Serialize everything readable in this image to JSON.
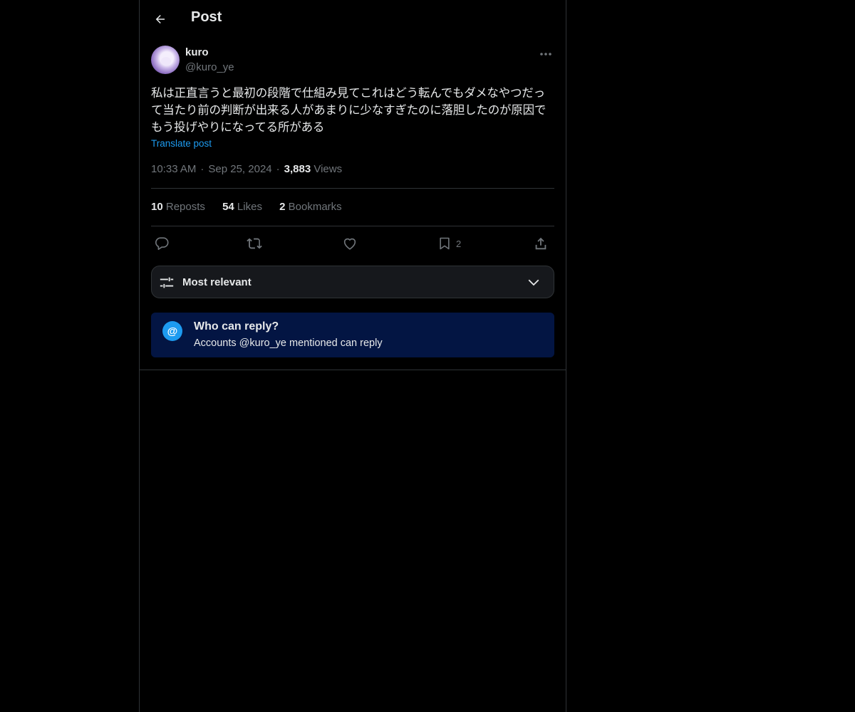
{
  "header": {
    "title": "Post"
  },
  "author": {
    "display_name": "kuro",
    "handle": "@kuro_ye"
  },
  "post": {
    "text": "私は正直言うと最初の段階で仕組み見てこれはどう転んでもダメなやつだって当たり前の判断が出来る人があまりに少なすぎたのに落胆したのが原因でもう投げやりになってる所がある",
    "translate_label": "Translate post",
    "time": "10:33 AM",
    "date": "Sep 25, 2024",
    "separator": "·",
    "views_count": "3,883",
    "views_label": "Views"
  },
  "stats": {
    "reposts_count": "10",
    "reposts_label": "Reposts",
    "likes_count": "54",
    "likes_label": "Likes",
    "bookmarks_count": "2",
    "bookmarks_label": "Bookmarks"
  },
  "actions": {
    "reply_icon": "reply-icon",
    "repost_icon": "repost-icon",
    "like_icon": "heart-icon",
    "bookmark_icon": "bookmark-icon",
    "bookmark_count": "2",
    "share_icon": "share-icon"
  },
  "sort": {
    "label": "Most relevant"
  },
  "reply_restriction": {
    "badge": "@",
    "title": "Who can reply?",
    "subtitle": "Accounts @kuro_ye mentioned can reply"
  },
  "colors": {
    "accent": "#1d9bf0",
    "background": "#000000",
    "notice_bg": "#031543",
    "muted": "#71767b"
  }
}
